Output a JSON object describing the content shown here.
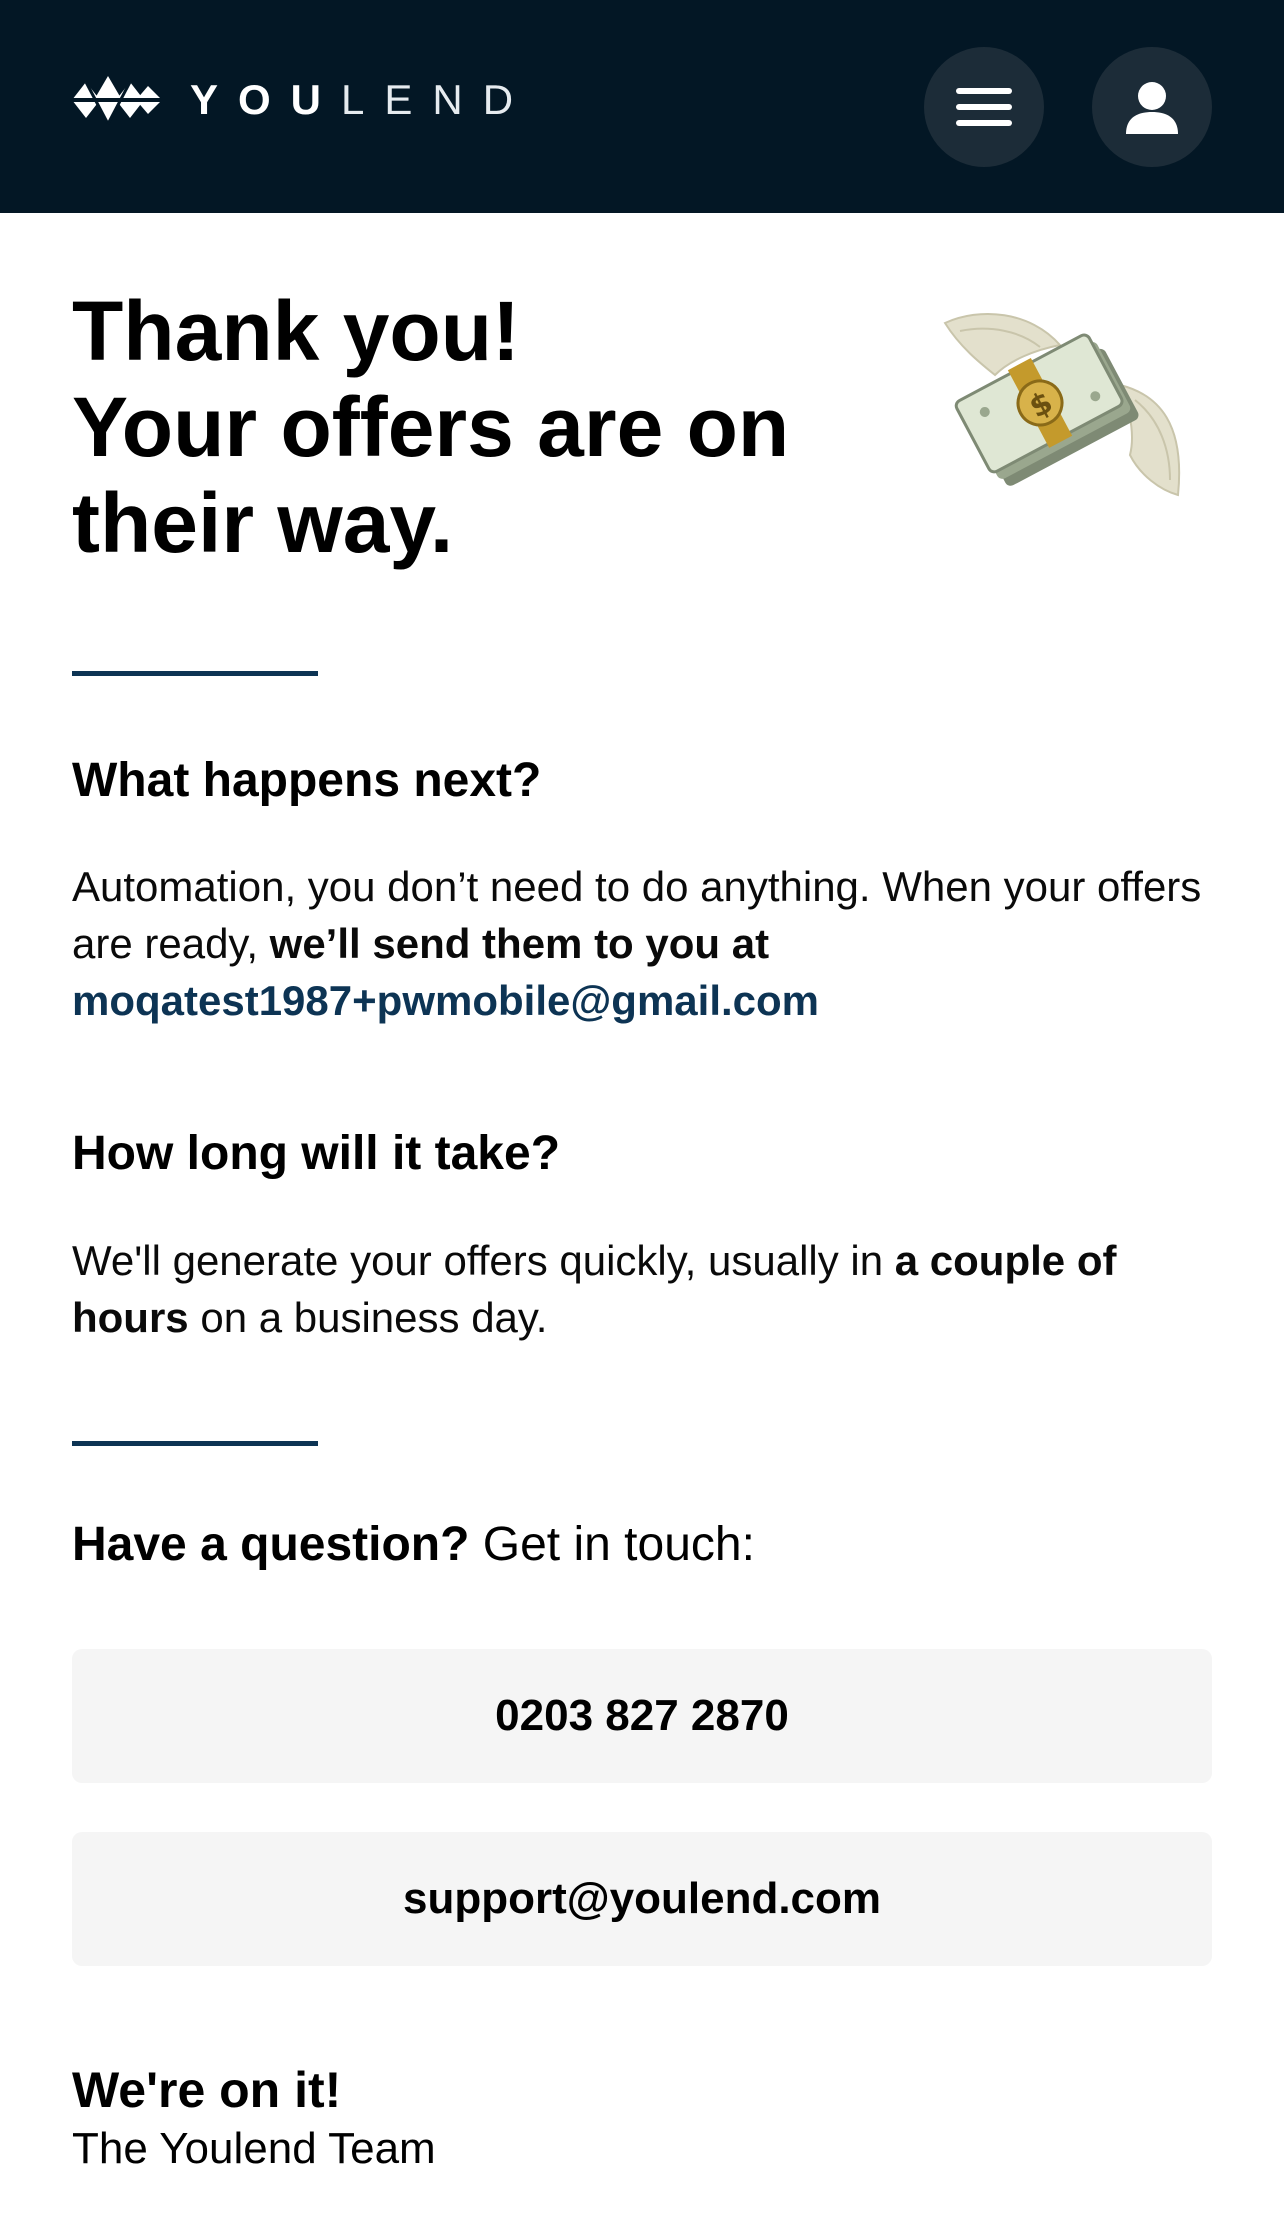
{
  "header": {
    "brand": {
      "you": "YOU",
      "lend": "LEND"
    },
    "icons": {
      "logo": "youlend-logo-icon",
      "menu": "hamburger-menu-icon",
      "user": "user-account-icon"
    },
    "colors": {
      "background": "#031725",
      "button_bg": "#1c2c38"
    }
  },
  "hero": {
    "title_line1": "Thank you!",
    "title_line2": "Your offers are on",
    "title_line3": "their way.",
    "illustration": "money-with-wings-icon"
  },
  "next": {
    "heading": "What happens next?",
    "text_lead": "Automation, you don’t need to do anything. When your offers are ready, ",
    "text_bold": "we’ll send them to you at",
    "email": "moqatest1987+pwmobile@gmail.com"
  },
  "timing": {
    "heading": "How long will it take?",
    "text_lead": "We'll generate your offers quickly, usually in ",
    "text_bold": "a couple of hours",
    "text_tail": " on a business day."
  },
  "contact": {
    "question_bold": "Have a question?",
    "question_rest": " Get in touch:",
    "phone": "0203 827 2870",
    "email": "support@youlend.com"
  },
  "signoff": {
    "title": "We're on it!",
    "name": "The Youlend Team"
  },
  "colors": {
    "accent": "#0d3454",
    "button_bg": "#f5f5f5"
  }
}
